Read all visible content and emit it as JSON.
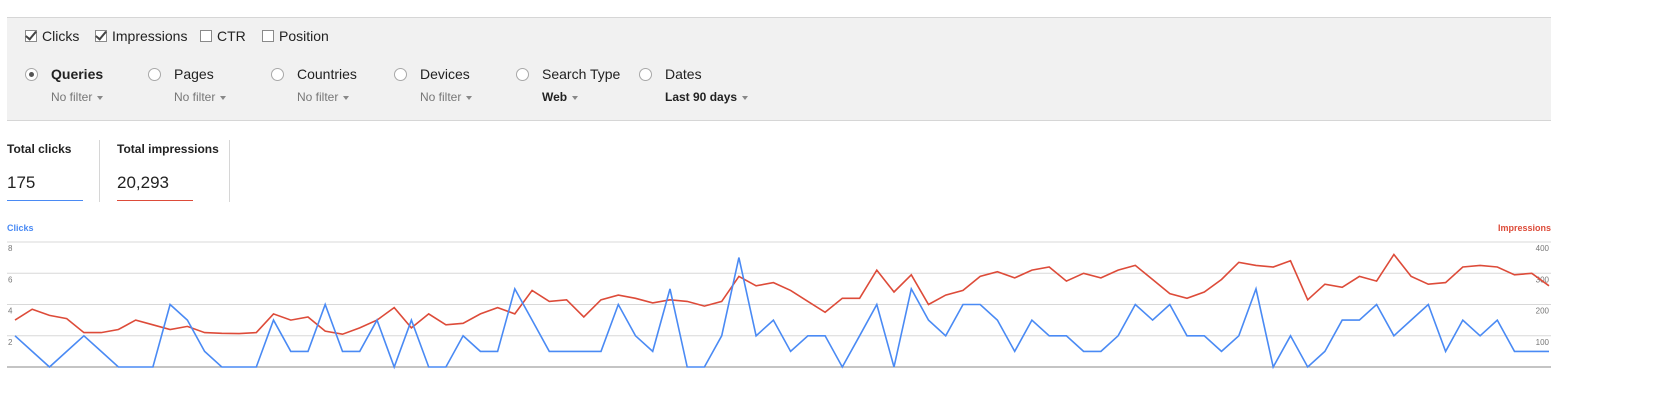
{
  "metrics": [
    {
      "label": "Clicks",
      "checked": true
    },
    {
      "label": "Impressions",
      "checked": true
    },
    {
      "label": "CTR",
      "checked": false
    },
    {
      "label": "Position",
      "checked": false
    }
  ],
  "dimensions": [
    {
      "label": "Queries",
      "value": "No filter",
      "selected": true
    },
    {
      "label": "Pages",
      "value": "No filter",
      "selected": false
    },
    {
      "label": "Countries",
      "value": "No filter",
      "selected": false
    },
    {
      "label": "Devices",
      "value": "No filter",
      "selected": false
    },
    {
      "label": "Search Type",
      "value": "Web",
      "selected": false
    },
    {
      "label": "Dates",
      "value": "Last 90 days",
      "selected": false
    }
  ],
  "totals": {
    "clicks": {
      "label": "Total clicks",
      "value": "175",
      "color": "#4a8af4"
    },
    "impressions": {
      "label": "Total impressions",
      "value": "20,293",
      "color": "#dd4b39"
    }
  },
  "colors": {
    "clicks": "#4a8af4",
    "impressions": "#dd4b39",
    "grid": "#d8d8d8"
  },
  "chart_data": {
    "type": "line",
    "ylabel": "Clicks",
    "y2label": "Impressions",
    "ylim": [
      0,
      8
    ],
    "y2lim": [
      0,
      400
    ],
    "yticks": [
      "2",
      "4",
      "6",
      "8"
    ],
    "y2ticks": [
      "100",
      "200",
      "300",
      "400"
    ],
    "series": [
      {
        "name": "Clicks",
        "axis": "left",
        "values": [
          2,
          1,
          0,
          1,
          2,
          1,
          0,
          0,
          0,
          4,
          3,
          1,
          0,
          0,
          0,
          3,
          1,
          1,
          4,
          1,
          1,
          3,
          0,
          3,
          0,
          0,
          2,
          1,
          1,
          5,
          3,
          1,
          1,
          1,
          1,
          4,
          2,
          1,
          5,
          0,
          0,
          2,
          7,
          2,
          3,
          1,
          2,
          2,
          0,
          2,
          4,
          0,
          5,
          3,
          2,
          4,
          4,
          3,
          1,
          3,
          2,
          2,
          1,
          1,
          2,
          4,
          3,
          4,
          2,
          2,
          1,
          2,
          5,
          0,
          2,
          0,
          1,
          3,
          3,
          4,
          2,
          3,
          4,
          1,
          3,
          2,
          3,
          1,
          1,
          1
        ]
      },
      {
        "name": "Impressions",
        "axis": "right",
        "values": [
          150,
          185,
          165,
          155,
          110,
          110,
          120,
          150,
          135,
          120,
          130,
          110,
          108,
          107,
          110,
          170,
          150,
          160,
          115,
          105,
          125,
          150,
          190,
          125,
          170,
          135,
          140,
          170,
          190,
          170,
          245,
          210,
          215,
          160,
          215,
          230,
          220,
          205,
          215,
          210,
          195,
          210,
          290,
          260,
          270,
          245,
          210,
          175,
          220,
          220,
          310,
          240,
          295,
          200,
          230,
          245,
          290,
          305,
          285,
          310,
          320,
          275,
          300,
          285,
          310,
          325,
          280,
          235,
          220,
          240,
          280,
          335,
          325,
          320,
          340,
          215,
          265,
          255,
          290,
          275,
          360,
          290,
          265,
          270,
          320,
          325,
          320,
          295,
          300,
          260
        ]
      }
    ]
  }
}
